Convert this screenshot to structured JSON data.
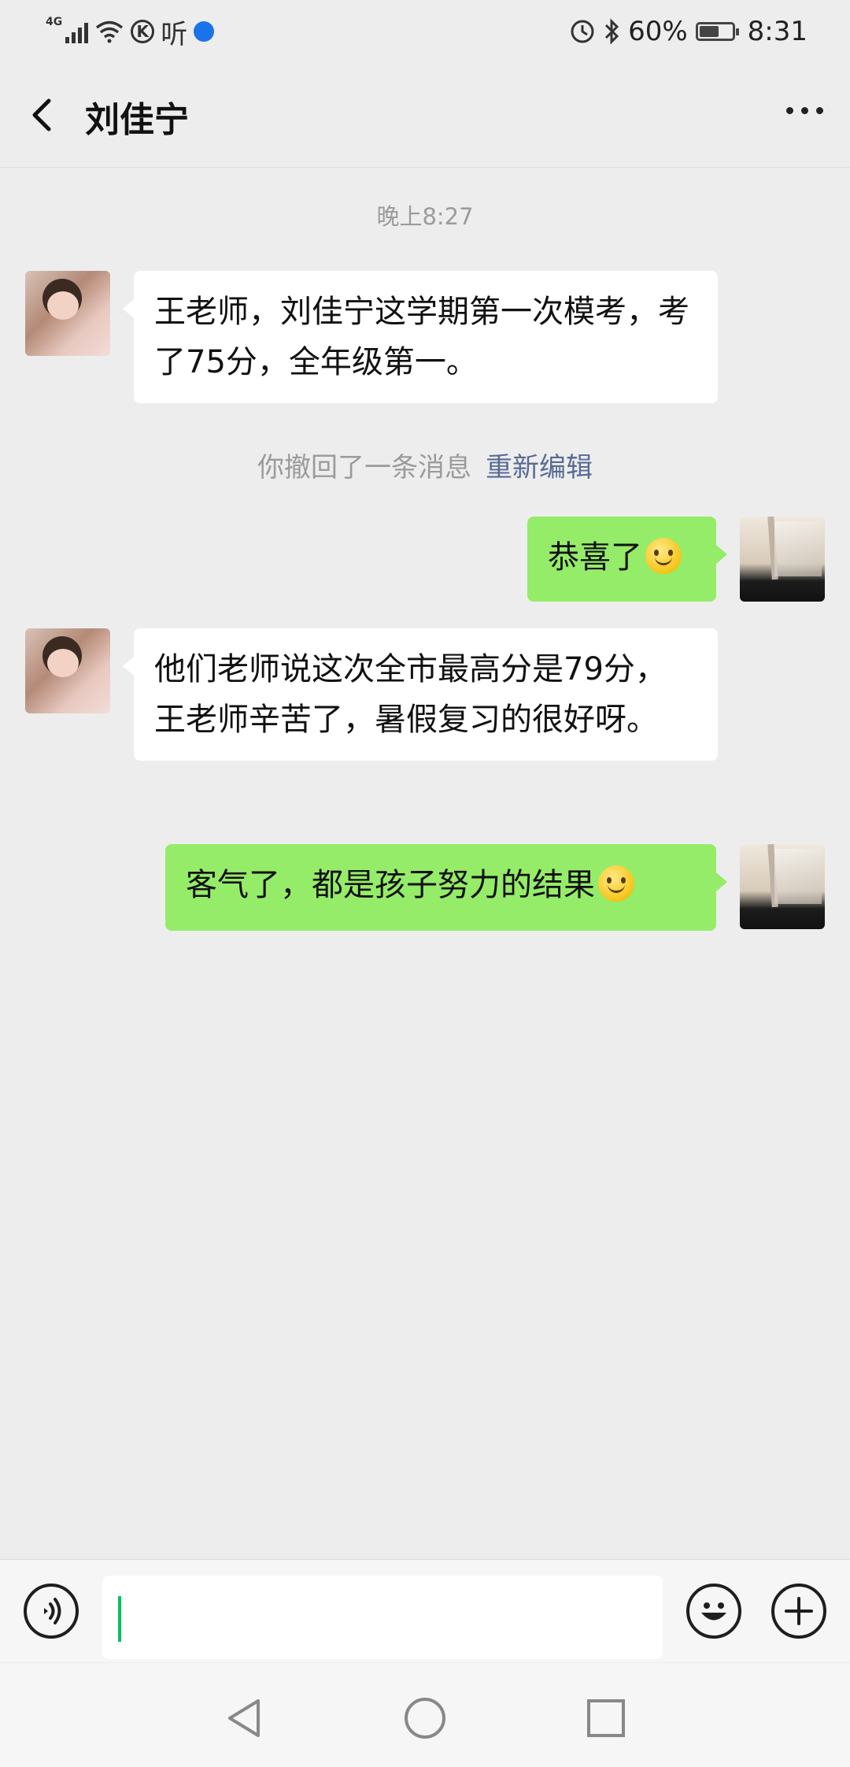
{
  "status_bar": {
    "network": "4G",
    "listen_icon_text": "听",
    "k_icon_text": "K",
    "battery_percent": "60%",
    "battery_level": 0.6,
    "time": "8:31"
  },
  "header": {
    "title": "刘佳宁"
  },
  "chat": {
    "timestamp": "晚上8:27",
    "messages": [
      {
        "side": "left",
        "text": "王老师，刘佳宁这学期第一次模考，考了75分，全年级第一。"
      },
      {
        "side": "right",
        "text": "恭喜了"
      },
      {
        "side": "left",
        "text": "他们老师说这次全市最高分是79分，王老师辛苦了，暑假复习的很好呀。"
      },
      {
        "side": "right",
        "text": "客气了，都是孩子努力的结果"
      }
    ],
    "recall_notice": "你撤回了一条消息",
    "recall_edit": "重新编辑"
  },
  "input_bar": {
    "value": "",
    "placeholder": ""
  },
  "icons": {
    "back": "back-icon",
    "more": "more-icon",
    "voice": "voice-icon",
    "emoji": "emoji-icon",
    "plus": "plus-icon",
    "smiley": "smiley-emoji"
  },
  "colors": {
    "background": "#ededed",
    "bubble_left": "#ffffff",
    "bubble_right": "#95ec69",
    "link": "#576b95",
    "caret": "#07c160"
  }
}
